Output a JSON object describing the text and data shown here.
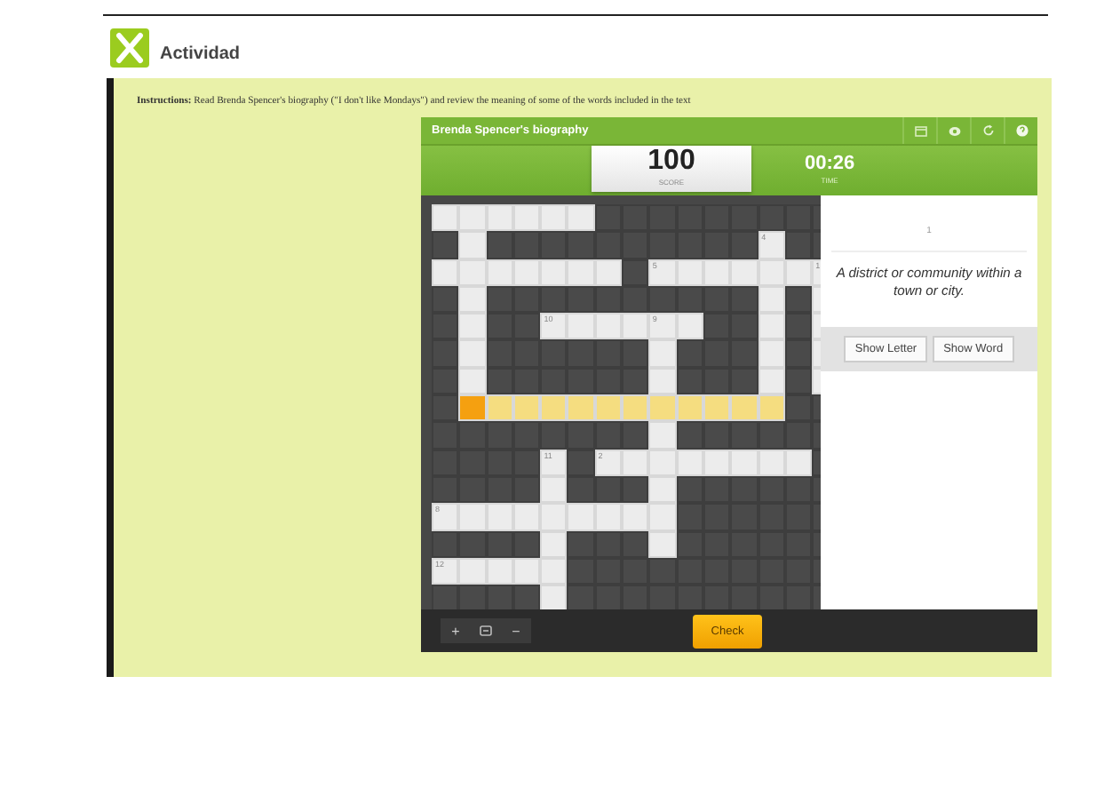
{
  "header": {
    "title": "Actividad"
  },
  "instructions": "**Instructions:** Read Brenda Spencer's biography (\"I don't like Mondays\") and review the meaning of some of the words included in the text",
  "game": {
    "title": "Brenda Spencer's biography",
    "score": "100",
    "score_label": "SCORE",
    "time": "00:26",
    "time_label": "TIME",
    "grid": [
      [
        {
          "kind": "blank"
        },
        {
          "kind": "blank"
        },
        {
          "kind": "blank"
        },
        {
          "kind": "blank"
        },
        {
          "kind": "blank"
        },
        {
          "kind": "blank"
        },
        {
          "kind": "block"
        },
        {
          "kind": "block"
        },
        {
          "kind": "block"
        },
        {
          "kind": "block"
        },
        {
          "kind": "block"
        },
        {
          "kind": "block"
        },
        {
          "kind": "block"
        },
        {
          "kind": "block"
        },
        {
          "kind": "block"
        }
      ],
      [
        {
          "kind": "block"
        },
        {
          "kind": "blank"
        },
        {
          "kind": "block"
        },
        {
          "kind": "block"
        },
        {
          "kind": "block"
        },
        {
          "kind": "block"
        },
        {
          "kind": "block"
        },
        {
          "kind": "block"
        },
        {
          "kind": "block"
        },
        {
          "kind": "block"
        },
        {
          "kind": "block"
        },
        {
          "kind": "block"
        },
        {
          "kind": "blank",
          "number": "4"
        },
        {
          "kind": "block"
        },
        {
          "kind": "block"
        }
      ],
      [
        {
          "kind": "blank"
        },
        {
          "kind": "blank"
        },
        {
          "kind": "blank"
        },
        {
          "kind": "blank"
        },
        {
          "kind": "blank"
        },
        {
          "kind": "blank"
        },
        {
          "kind": "blank"
        },
        {
          "kind": "block"
        },
        {
          "kind": "blank",
          "number": "5"
        },
        {
          "kind": "blank"
        },
        {
          "kind": "blank"
        },
        {
          "kind": "blank"
        },
        {
          "kind": "blank"
        },
        {
          "kind": "blank"
        },
        {
          "kind": "blank",
          "number": "1"
        }
      ],
      [
        {
          "kind": "block"
        },
        {
          "kind": "blank"
        },
        {
          "kind": "block"
        },
        {
          "kind": "block"
        },
        {
          "kind": "block"
        },
        {
          "kind": "block"
        },
        {
          "kind": "block"
        },
        {
          "kind": "block"
        },
        {
          "kind": "block"
        },
        {
          "kind": "block"
        },
        {
          "kind": "block"
        },
        {
          "kind": "block"
        },
        {
          "kind": "blank"
        },
        {
          "kind": "block"
        },
        {
          "kind": "blank"
        }
      ],
      [
        {
          "kind": "block"
        },
        {
          "kind": "blank"
        },
        {
          "kind": "block"
        },
        {
          "kind": "block"
        },
        {
          "kind": "blank",
          "number": "10"
        },
        {
          "kind": "blank"
        },
        {
          "kind": "blank"
        },
        {
          "kind": "blank"
        },
        {
          "kind": "blank",
          "number": "9"
        },
        {
          "kind": "blank"
        },
        {
          "kind": "block"
        },
        {
          "kind": "block"
        },
        {
          "kind": "blank"
        },
        {
          "kind": "block"
        },
        {
          "kind": "blank"
        }
      ],
      [
        {
          "kind": "block"
        },
        {
          "kind": "blank"
        },
        {
          "kind": "block"
        },
        {
          "kind": "block"
        },
        {
          "kind": "block"
        },
        {
          "kind": "block"
        },
        {
          "kind": "block"
        },
        {
          "kind": "block"
        },
        {
          "kind": "blank"
        },
        {
          "kind": "block"
        },
        {
          "kind": "block"
        },
        {
          "kind": "block"
        },
        {
          "kind": "blank"
        },
        {
          "kind": "block"
        },
        {
          "kind": "blank"
        }
      ],
      [
        {
          "kind": "block"
        },
        {
          "kind": "blank"
        },
        {
          "kind": "block"
        },
        {
          "kind": "block"
        },
        {
          "kind": "block"
        },
        {
          "kind": "block"
        },
        {
          "kind": "block"
        },
        {
          "kind": "block"
        },
        {
          "kind": "blank"
        },
        {
          "kind": "block"
        },
        {
          "kind": "block"
        },
        {
          "kind": "block"
        },
        {
          "kind": "blank"
        },
        {
          "kind": "block"
        },
        {
          "kind": "blank"
        }
      ],
      [
        {
          "kind": "block"
        },
        {
          "kind": "active"
        },
        {
          "kind": "highlight"
        },
        {
          "kind": "highlight"
        },
        {
          "kind": "highlight"
        },
        {
          "kind": "highlight"
        },
        {
          "kind": "highlight"
        },
        {
          "kind": "highlight"
        },
        {
          "kind": "highlight"
        },
        {
          "kind": "highlight"
        },
        {
          "kind": "highlight"
        },
        {
          "kind": "highlight"
        },
        {
          "kind": "highlight"
        },
        {
          "kind": "block"
        },
        {
          "kind": "block"
        }
      ],
      [
        {
          "kind": "block"
        },
        {
          "kind": "block"
        },
        {
          "kind": "block"
        },
        {
          "kind": "block"
        },
        {
          "kind": "block"
        },
        {
          "kind": "block"
        },
        {
          "kind": "block"
        },
        {
          "kind": "block"
        },
        {
          "kind": "blank"
        },
        {
          "kind": "block"
        },
        {
          "kind": "block"
        },
        {
          "kind": "block"
        },
        {
          "kind": "block"
        },
        {
          "kind": "block"
        },
        {
          "kind": "block"
        }
      ],
      [
        {
          "kind": "block"
        },
        {
          "kind": "block"
        },
        {
          "kind": "block"
        },
        {
          "kind": "block"
        },
        {
          "kind": "blank",
          "number": "11"
        },
        {
          "kind": "block"
        },
        {
          "kind": "blank",
          "number": "2"
        },
        {
          "kind": "blank"
        },
        {
          "kind": "blank"
        },
        {
          "kind": "blank"
        },
        {
          "kind": "blank"
        },
        {
          "kind": "blank"
        },
        {
          "kind": "blank"
        },
        {
          "kind": "blank"
        },
        {
          "kind": "block"
        }
      ],
      [
        {
          "kind": "block"
        },
        {
          "kind": "block"
        },
        {
          "kind": "block"
        },
        {
          "kind": "block"
        },
        {
          "kind": "blank"
        },
        {
          "kind": "block"
        },
        {
          "kind": "block"
        },
        {
          "kind": "block"
        },
        {
          "kind": "blank"
        },
        {
          "kind": "block"
        },
        {
          "kind": "block"
        },
        {
          "kind": "block"
        },
        {
          "kind": "block"
        },
        {
          "kind": "block"
        },
        {
          "kind": "block"
        }
      ],
      [
        {
          "kind": "blank",
          "number": "8"
        },
        {
          "kind": "blank"
        },
        {
          "kind": "blank"
        },
        {
          "kind": "blank"
        },
        {
          "kind": "blank"
        },
        {
          "kind": "blank"
        },
        {
          "kind": "blank"
        },
        {
          "kind": "blank"
        },
        {
          "kind": "blank"
        },
        {
          "kind": "block"
        },
        {
          "kind": "block"
        },
        {
          "kind": "block"
        },
        {
          "kind": "block"
        },
        {
          "kind": "block"
        },
        {
          "kind": "block"
        }
      ],
      [
        {
          "kind": "block"
        },
        {
          "kind": "block"
        },
        {
          "kind": "block"
        },
        {
          "kind": "block"
        },
        {
          "kind": "blank"
        },
        {
          "kind": "block"
        },
        {
          "kind": "block"
        },
        {
          "kind": "block"
        },
        {
          "kind": "blank"
        },
        {
          "kind": "block"
        },
        {
          "kind": "block"
        },
        {
          "kind": "block"
        },
        {
          "kind": "block"
        },
        {
          "kind": "block"
        },
        {
          "kind": "block"
        }
      ],
      [
        {
          "kind": "blank",
          "number": "12"
        },
        {
          "kind": "blank"
        },
        {
          "kind": "blank"
        },
        {
          "kind": "blank"
        },
        {
          "kind": "blank"
        },
        {
          "kind": "block"
        },
        {
          "kind": "block"
        },
        {
          "kind": "block"
        },
        {
          "kind": "block"
        },
        {
          "kind": "block"
        },
        {
          "kind": "block"
        },
        {
          "kind": "block"
        },
        {
          "kind": "block"
        },
        {
          "kind": "block"
        },
        {
          "kind": "block"
        }
      ],
      [
        {
          "kind": "block"
        },
        {
          "kind": "block"
        },
        {
          "kind": "block"
        },
        {
          "kind": "block"
        },
        {
          "kind": "blank"
        },
        {
          "kind": "block"
        },
        {
          "kind": "block"
        },
        {
          "kind": "block"
        },
        {
          "kind": "block"
        },
        {
          "kind": "block"
        },
        {
          "kind": "block"
        },
        {
          "kind": "block"
        },
        {
          "kind": "block"
        },
        {
          "kind": "block"
        },
        {
          "kind": "block"
        }
      ]
    ],
    "clue": {
      "number": "1",
      "text": "A district or community within a town or city."
    },
    "clue_buttons": [
      "Show Letter",
      "Show Word"
    ],
    "zoom_buttons": [
      {
        "kind": "plus",
        "label": "+"
      },
      {
        "kind": "fit"
      },
      {
        "kind": "minus",
        "label": "−"
      }
    ],
    "check": "Check"
  }
}
